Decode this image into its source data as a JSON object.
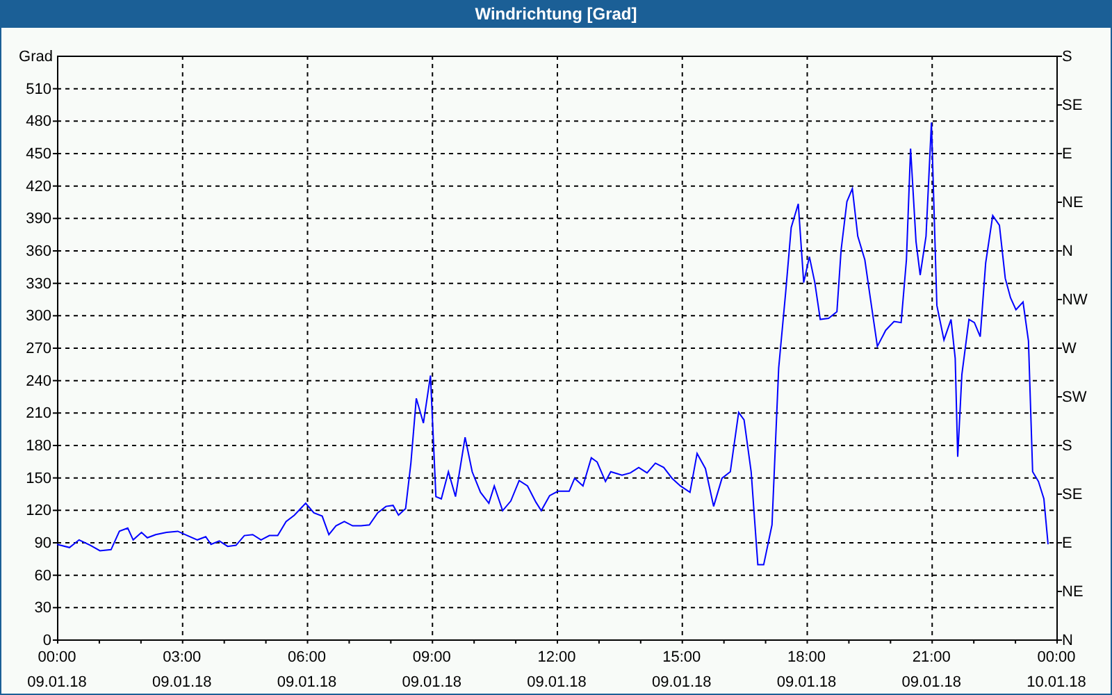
{
  "window": {
    "title": "Windrichtung [Grad]"
  },
  "chart": {
    "chart_data": {
      "type": "line",
      "grid": true,
      "ylabel": "Grad",
      "xlim": [
        0,
        24
      ],
      "ylim": [
        0,
        540
      ],
      "xticks": [
        {
          "value": 0,
          "label": "00:00"
        },
        {
          "value": 3,
          "label": "03:00"
        },
        {
          "value": 6,
          "label": "06:00"
        },
        {
          "value": 9,
          "label": "09:00"
        },
        {
          "value": 12,
          "label": "12:00"
        },
        {
          "value": 15,
          "label": "15:00"
        },
        {
          "value": 18,
          "label": "18:00"
        },
        {
          "value": 21,
          "label": "21:00"
        },
        {
          "value": 24,
          "label": "00:00"
        }
      ],
      "yticks": [
        0,
        30,
        60,
        90,
        120,
        150,
        180,
        210,
        240,
        270,
        300,
        330,
        360,
        390,
        420,
        450,
        480,
        510
      ],
      "x": [
        0,
        0.3,
        0.53,
        0.8,
        1.03,
        1.3,
        1.5,
        1.7,
        1.83,
        2.03,
        2.17,
        2.37,
        2.63,
        2.9,
        3.13,
        3.37,
        3.57,
        3.7,
        3.9,
        4.1,
        4.3,
        4.5,
        4.7,
        4.9,
        5.1,
        5.3,
        5.5,
        5.7,
        5.97,
        6.17,
        6.37,
        6.53,
        6.7,
        6.9,
        7.1,
        7.3,
        7.5,
        7.7,
        7.9,
        8.07,
        8.2,
        8.37,
        8.5,
        8.63,
        8.8,
        8.97,
        9.1,
        9.23,
        9.4,
        9.57,
        9.8,
        9.97,
        10.17,
        10.37,
        10.5,
        10.7,
        10.9,
        11.1,
        11.3,
        11.5,
        11.63,
        11.83,
        12.03,
        12.3,
        12.43,
        12.63,
        12.83,
        12.97,
        13.17,
        13.3,
        13.57,
        13.77,
        13.97,
        14.17,
        14.37,
        14.57,
        14.77,
        14.97,
        15.2,
        15.37,
        15.57,
        15.77,
        15.97,
        16.17,
        16.37,
        16.5,
        16.67,
        16.83,
        16.97,
        17.17,
        17.33,
        17.5,
        17.63,
        17.8,
        17.93,
        18.07,
        18.2,
        18.33,
        18.53,
        18.73,
        18.83,
        18.97,
        19.1,
        19.23,
        19.4,
        19.53,
        19.7,
        19.9,
        20.1,
        20.27,
        20.4,
        20.5,
        20.63,
        20.73,
        20.87,
        21,
        21.13,
        21.3,
        21.47,
        21.57,
        21.63,
        21.73,
        21.9,
        22.03,
        22.17,
        22.3,
        22.47,
        22.63,
        22.77,
        22.9,
        23.03,
        23.2,
        23.33,
        23.43,
        23.57,
        23.7,
        23.8
      ],
      "values": [
        88,
        85,
        92,
        87,
        82,
        83,
        100,
        103,
        92,
        99,
        94,
        97,
        99,
        100,
        96,
        92,
        95,
        88,
        91,
        86,
        87,
        96,
        97,
        92,
        96,
        96,
        109,
        115,
        126,
        117,
        114,
        97,
        105,
        109,
        105,
        105,
        106,
        117,
        123,
        124,
        115,
        121,
        163,
        223,
        200,
        244,
        132,
        130,
        155,
        132,
        187,
        155,
        136,
        126,
        142,
        119,
        128,
        147,
        142,
        127,
        119,
        133,
        137,
        137,
        149,
        142,
        168,
        164,
        146,
        155,
        152,
        154,
        159,
        154,
        163,
        159,
        149,
        142,
        136,
        172,
        158,
        123,
        149,
        155,
        210,
        203,
        155,
        69,
        69,
        106,
        251,
        322,
        381,
        403,
        330,
        354,
        330,
        296,
        297,
        303,
        360,
        405,
        417,
        373,
        351,
        316,
        271,
        286,
        294,
        293,
        351,
        454,
        368,
        337,
        373,
        478,
        309,
        277,
        296,
        260,
        169,
        245,
        296,
        293,
        280,
        348,
        392,
        383,
        334,
        316,
        305,
        312,
        276,
        155,
        146,
        130,
        88
      ]
    },
    "date_labels": [
      "09.01.18",
      "09.01.18",
      "09.01.18",
      "09.01.18",
      "09.01.18",
      "09.01.18",
      "09.01.18",
      "09.01.18",
      "10.01.18"
    ],
    "compass_labels": [
      "S",
      "SE",
      "E",
      "NE",
      "N",
      "NW",
      "W",
      "SW",
      "S",
      "SE",
      "E",
      "NE",
      "N"
    ]
  }
}
